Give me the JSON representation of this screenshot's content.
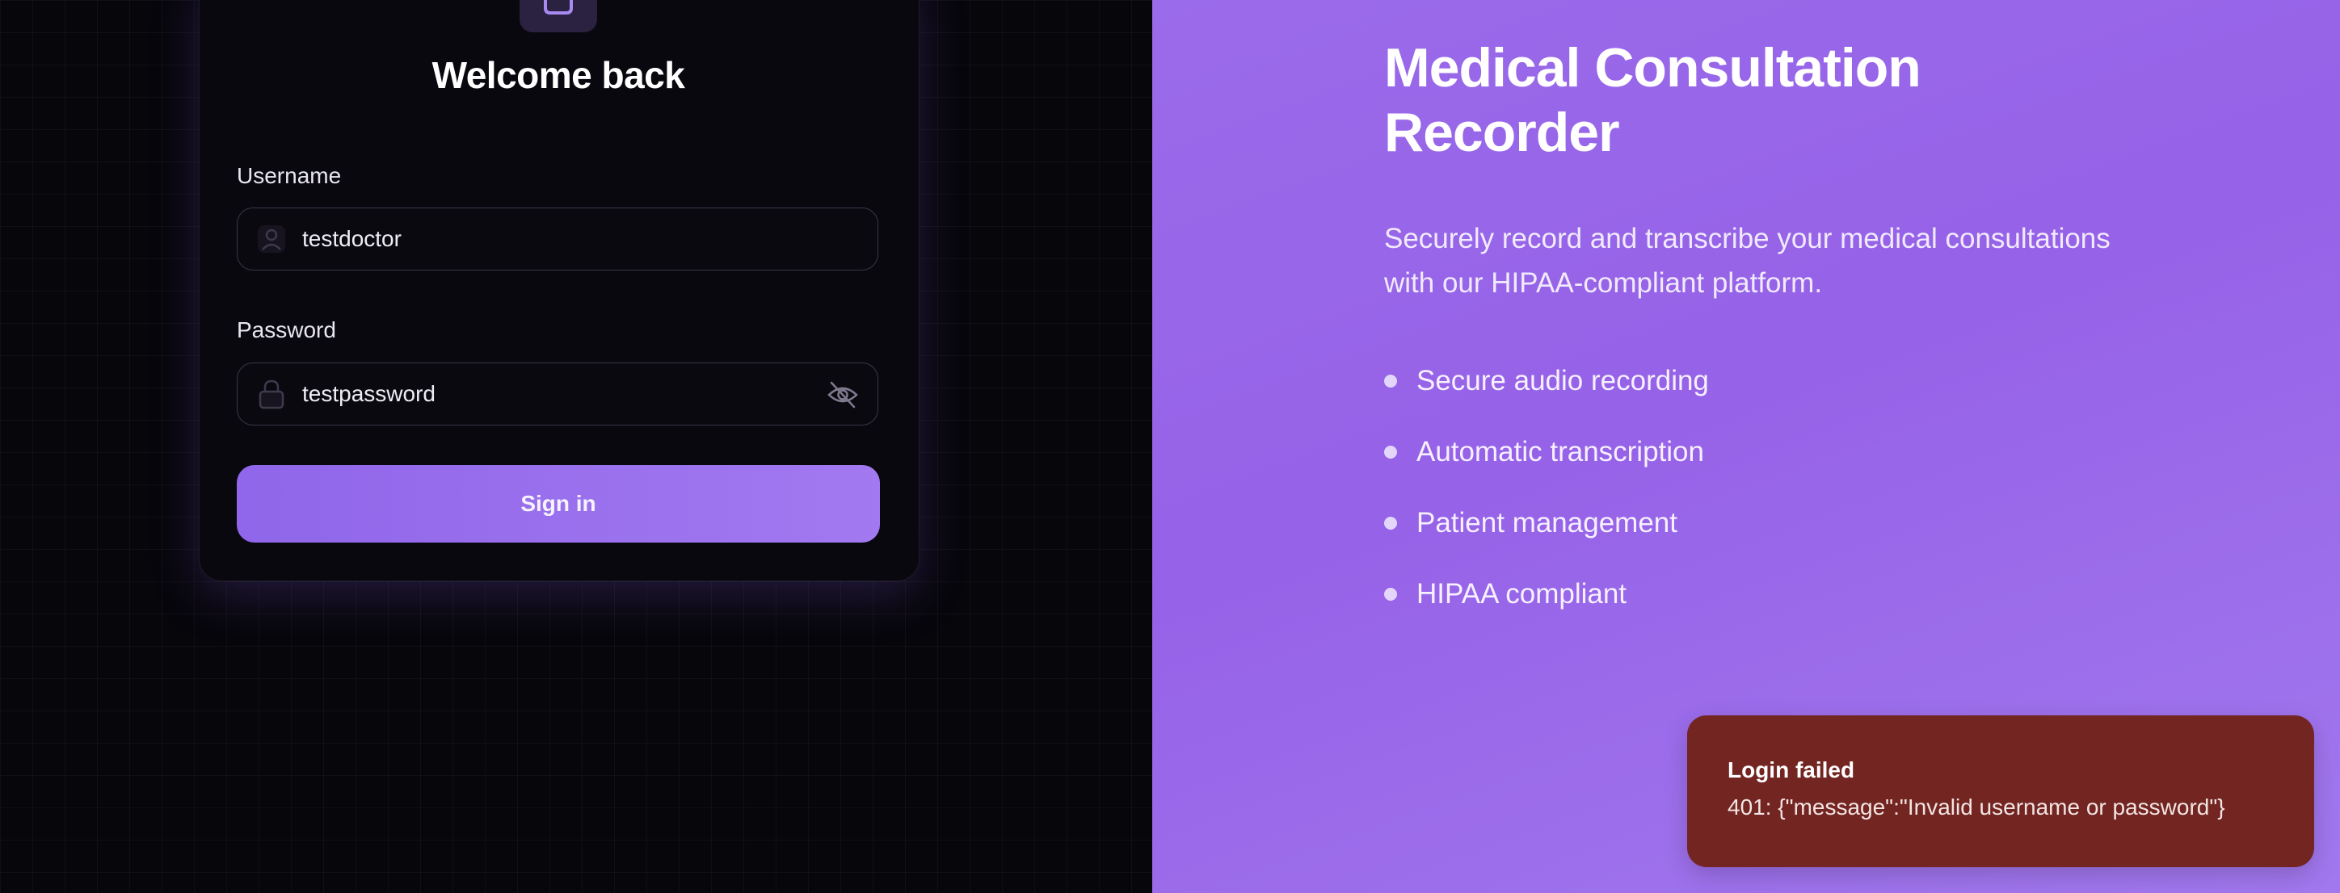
{
  "login": {
    "heading": "Welcome back",
    "username": {
      "label": "Username",
      "value": "testdoctor"
    },
    "password": {
      "label": "Password",
      "value": "testpassword"
    },
    "signin_label": "Sign in"
  },
  "promo": {
    "title": "Medical Consultation Recorder",
    "description": "Securely record and transcribe your medical consultations with our HIPAA-compliant platform.",
    "features": [
      "Secure audio recording",
      "Automatic transcription",
      "Patient management",
      "HIPAA compliant"
    ]
  },
  "toast": {
    "title": "Login failed",
    "message": "401: {\"message\":\"Invalid username or password\"}"
  },
  "icons": {
    "logo": "app-logo-icon",
    "user": "user-icon",
    "lock": "lock-icon",
    "eye": "eye-off-icon"
  },
  "colors": {
    "accent": "#9a6bea",
    "button": "#9a70ee",
    "toast_bg": "#732522",
    "left_bg": "#07060b"
  }
}
